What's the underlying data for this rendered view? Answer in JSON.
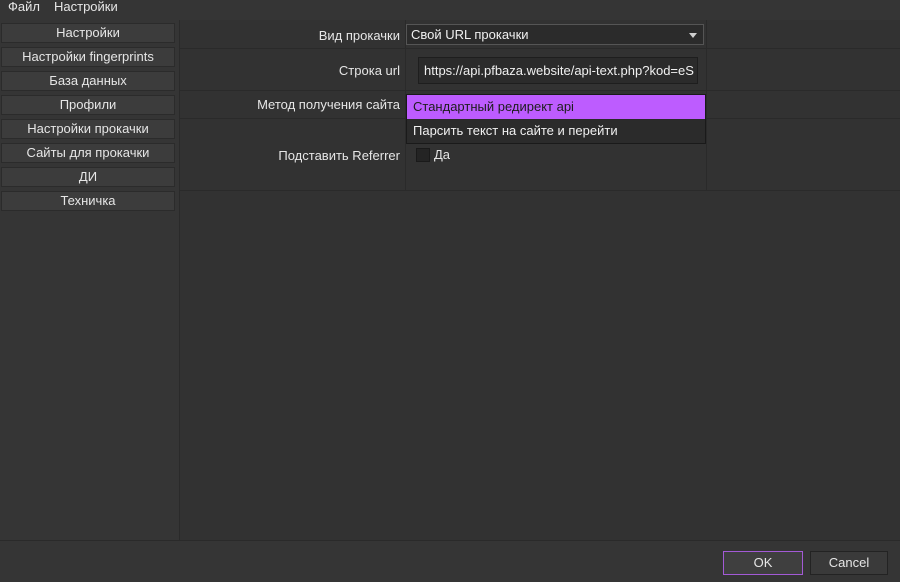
{
  "menubar": {
    "items": [
      {
        "label": "Файл"
      },
      {
        "label": "Настройки"
      }
    ]
  },
  "sidebar": {
    "items": [
      {
        "label": "Настройки"
      },
      {
        "label": "Настройки fingerprints"
      },
      {
        "label": "База данных"
      },
      {
        "label": "Профили"
      },
      {
        "label": "Настройки прокачки"
      },
      {
        "label": "Сайты для прокачки"
      },
      {
        "label": "ДИ"
      },
      {
        "label": "Техничка"
      }
    ]
  },
  "form": {
    "pump_type_label": "Вид прокачки",
    "pump_type_value": "Свой URL прокачки",
    "url_label": "Строка url",
    "url_value": "https://api.pfbaza.website/api-text.php?kod=eS",
    "method_label": "Метод получения сайта",
    "method_options": [
      {
        "label": "Стандартный редирект api",
        "selected": true
      },
      {
        "label": "Парсить текст на сайте и перейти",
        "selected": false
      }
    ],
    "referrer_label": "Подставить Referrer",
    "referrer_check_label": "Да",
    "referrer_checked": false
  },
  "footer": {
    "ok_label": "OK",
    "cancel_label": "Cancel"
  },
  "colors": {
    "accent": "#bd5cff",
    "background": "#353535"
  }
}
